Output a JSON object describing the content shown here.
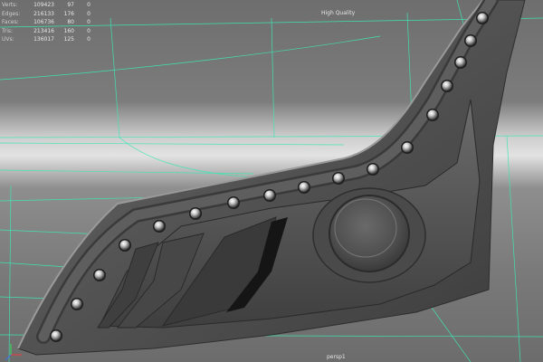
{
  "hud": {
    "rows": [
      {
        "label": "Verts:",
        "v1": "109423",
        "v2": "97",
        "v3": "0"
      },
      {
        "label": "Edges:",
        "v1": "216133",
        "v2": "176",
        "v3": "0"
      },
      {
        "label": "Faces:",
        "v1": "106736",
        "v2": "80",
        "v3": "0"
      },
      {
        "label": "Tris:",
        "v1": "213416",
        "v2": "160",
        "v3": "0"
      },
      {
        "label": "UVs:",
        "v1": "136017",
        "v2": "125",
        "v3": "0"
      }
    ]
  },
  "render_mode": "High Quality",
  "camera_name": "persp1",
  "colors": {
    "grid_line": "#3ee6b4",
    "background_top": "#6e6e6e",
    "background_band": "#dcdcdc",
    "model_base": "#5a5a5a",
    "led_highlight": "#ffffff"
  },
  "icons": {
    "view_axis": "axis-gizmo-icon"
  }
}
